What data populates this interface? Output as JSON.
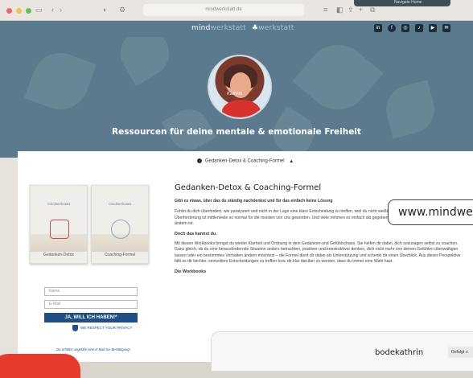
{
  "browser": {
    "url": "mindwerkstatt.de",
    "top_pill_text": "Navigate Home"
  },
  "site": {
    "logo_main": "mind",
    "logo_faint": "werkstatt",
    "logo_tail": "werkstatt",
    "social_icons": [
      "linkedin-icon",
      "facebook-icon",
      "instagram-icon",
      "tiktok-icon",
      "youtube-icon",
      "mail-icon"
    ]
  },
  "hero": {
    "signature": "Kathrin",
    "title": "Ressourcen für deine mentale & emotionale Freiheit"
  },
  "toc": {
    "label": "Gedanken-Detox & Coaching-Formel",
    "caret": "▲"
  },
  "books": [
    {
      "brand": "mindwerkstatt",
      "name": "Gedanken-Detox"
    },
    {
      "brand": "mindwerkstatt",
      "name": "Coaching-Formel"
    }
  ],
  "form": {
    "name_placeholder": "Name",
    "email_placeholder": "E-Mail",
    "cta": "JA, WILL ICH HABEN!*",
    "privacy": "WE RESPECT YOUR PRIVACY",
    "note": "Du erhältst ungefähr eine E-Mail zur Bestätigung!"
  },
  "article": {
    "title": "Gedanken-Detox & Coaching-Formel",
    "lead": "Gibt es etwas, über das du ständig nachdenkst und für das einfach keine Lösung",
    "p1": "Fühlst du dich überfordert, wie paralysiert und nicht in der Lage eine klare Entscheidung zu treffen, weil du nicht weißt, was du tun sollst? Das Gefühl der Überforderung ist mittlerweile so normal für die meisten von uns geworden. Und viele nehmen es einfach als gegeben hin und glauben, dass daran nichts zu ändern ist.",
    "h1": "Doch das kannst du.",
    "p2": "Mit diesen Workbooks bringst du wieder Klarheit und Ordnung in dein Gedanken-und Gefühlschaos. Sie helfen dir dabei, dich sozusagen selbst zu coachen. Ganz gleich, ob du eine herausfordernde Situation anders betrachten, positiver und konstruktiver denken, dich nicht mehr von deinen Gefühlen überwältigen lassen oder ein bestimmtes Verhalten ändern möchtest – die Formel dient dir dabei als Unterstützung und schenkt dir einen Überblick. Aus dieser Perspektive fällt es dir leichter, sinnvollere Entscheidungen zu treffen bzw. dir klar darüber zu werden, dass du immer eine Wahl hast.",
    "h2": "Die Workbooks"
  },
  "overlays": {
    "url_text": "www.mindwerkstatt.de",
    "username": "bodekathrin",
    "follow": "Gefolgt ∨"
  }
}
